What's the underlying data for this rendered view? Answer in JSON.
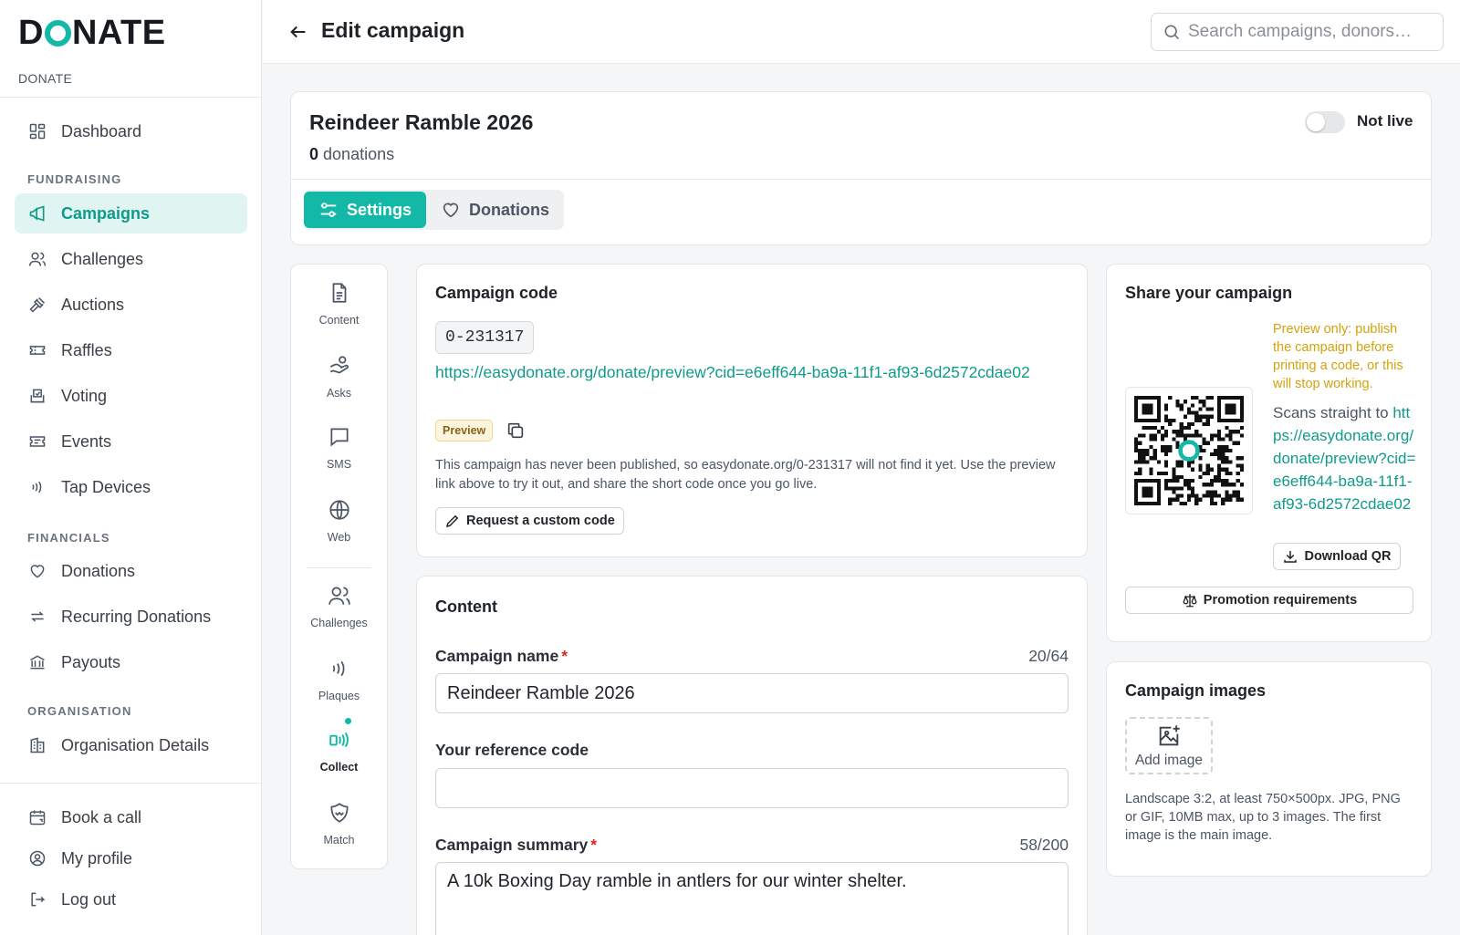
{
  "brand": {
    "logo": "DONATE",
    "subtitle": "DONATE",
    "accent_color": "#14b8a6"
  },
  "sidebar": {
    "items": [
      {
        "label": "Dashboard",
        "icon": "dashboard-grid-icon"
      },
      {
        "section": "FUNDRAISING"
      },
      {
        "label": "Campaigns",
        "icon": "megaphone-icon",
        "active": true
      },
      {
        "label": "Challenges",
        "icon": "people-icon"
      },
      {
        "label": "Auctions",
        "icon": "gavel-icon"
      },
      {
        "label": "Raffles",
        "icon": "ticket-icon"
      },
      {
        "label": "Voting",
        "icon": "ballot-box-icon"
      },
      {
        "label": "Events",
        "icon": "event-ticket-icon"
      },
      {
        "label": "Tap Devices",
        "icon": "contactless-icon"
      },
      {
        "section": "FINANCIALS"
      },
      {
        "label": "Donations",
        "icon": "heart-icon"
      },
      {
        "label": "Recurring Donations",
        "icon": "repeat-icon"
      },
      {
        "label": "Payouts",
        "icon": "bank-icon"
      },
      {
        "section": "ORGANISATION"
      },
      {
        "label": "Organisation Details",
        "icon": "building-icon"
      }
    ],
    "sections": {
      "fundraising": "FUNDRAISING",
      "financials": "FINANCIALS",
      "organisation": "ORGANISATION"
    },
    "labels": {
      "dashboard": "Dashboard",
      "campaigns": "Campaigns",
      "challenges": "Challenges",
      "auctions": "Auctions",
      "raffles": "Raffles",
      "voting": "Voting",
      "events": "Events",
      "tap_devices": "Tap Devices",
      "donations": "Donations",
      "recurring": "Recurring Donations",
      "payouts": "Payouts",
      "org_details": "Organisation Details",
      "book_call": "Book a call",
      "profile": "My profile",
      "logout": "Log out"
    }
  },
  "topbar": {
    "title": "Edit campaign",
    "search_placeholder": "Search campaigns, donors…"
  },
  "campaign": {
    "name": "Reindeer Ramble 2026",
    "donation_count": "0",
    "donation_suffix": "donations",
    "live_status": "Not live",
    "is_live": false
  },
  "tabs": {
    "settings": "Settings",
    "donations": "Donations",
    "active": "settings"
  },
  "rail": {
    "content": "Content",
    "asks": "Asks",
    "sms": "SMS",
    "web": "Web",
    "challenges": "Challenges",
    "plaques": "Plaques",
    "collect": "Collect",
    "match": "Match"
  },
  "code_card": {
    "title": "Campaign code",
    "code": "0-231317",
    "preview_url": "https://easydonate.org/donate/preview?cid=e6eff644-ba9a-11f1-af93-6d2572cdae02",
    "badge": "Preview",
    "note": "This campaign has never been published, so easydonate.org/0-231317 will not find it yet. Use the preview link above to try it out, and share the short code once you go live.",
    "request_button": "Request a custom code"
  },
  "content_card": {
    "title": "Content",
    "name_label": "Campaign name",
    "name_value": "Reindeer Ramble 2026",
    "name_counter": "20/64",
    "ref_label": "Your reference code",
    "ref_value": "",
    "summary_label": "Campaign summary",
    "summary_value": "A 10k Boxing Day ramble in antlers for our winter shelter.",
    "summary_counter": "58/200"
  },
  "share_card": {
    "title": "Share your campaign",
    "warning": "Preview only: publish the campaign before printing a code, or this will stop working.",
    "scans_prefix": "Scans straight to ",
    "scans_url": "https://easydonate.org/donate/preview?cid=e6eff644-ba9a-11f1-af93-6d2572cdae02",
    "download_button": "Download QR",
    "promo_button": "Promotion requirements"
  },
  "images_card": {
    "title": "Campaign images",
    "add_label": "Add image",
    "note": "Landscape 3:2, at least 750×500px. JPG, PNG or GIF, 10MB max, up to 3 images. The first image is the main image."
  },
  "colors": {
    "accent": "#14b8a6",
    "accent_text": "#0f9a8a",
    "warning": "#d4a20b",
    "required": "#dc2626"
  }
}
